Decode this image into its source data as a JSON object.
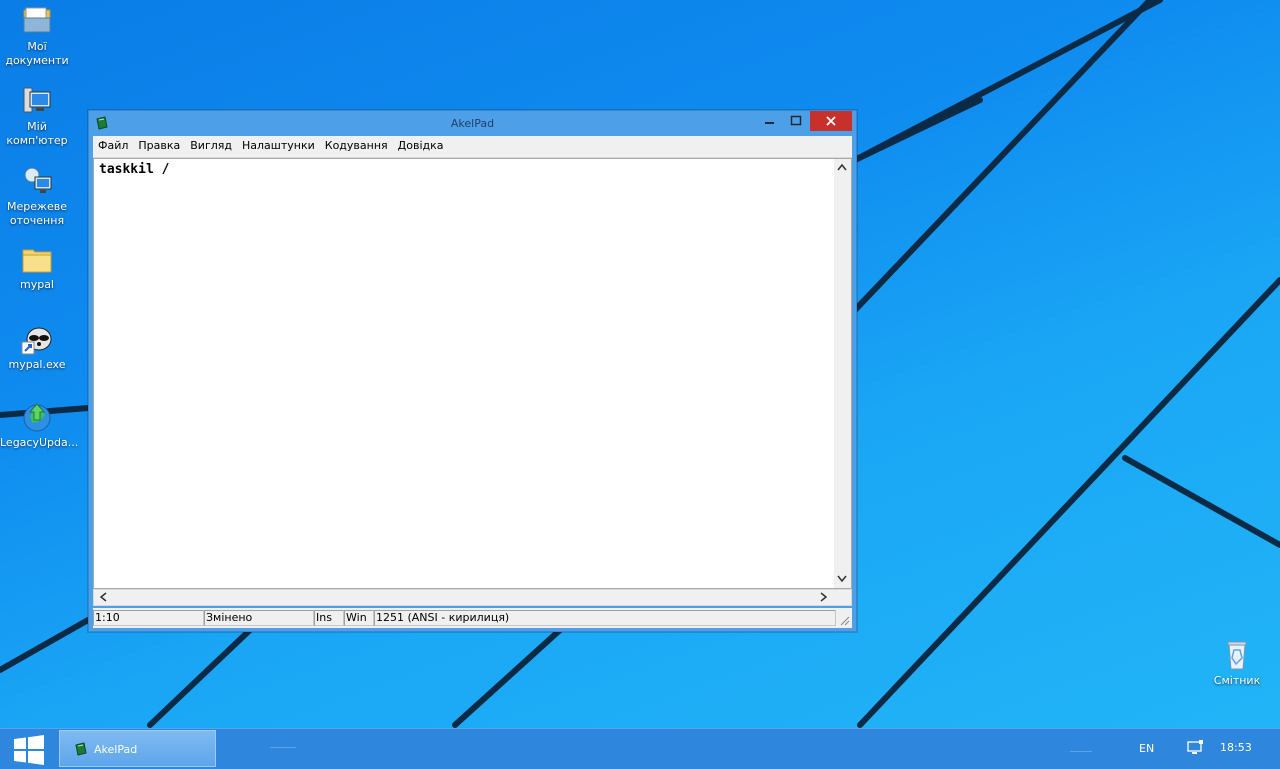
{
  "desktop": {
    "icons": [
      {
        "label_line1": "Мої",
        "label_line2": "документи",
        "icon": "documents-folder-icon"
      },
      {
        "label_line1": "Мій",
        "label_line2": "комп'ютер",
        "icon": "computer-icon"
      },
      {
        "label_line1": "Мережеве",
        "label_line2": "оточення",
        "icon": "network-icon"
      },
      {
        "label_line1": "mypal",
        "label_line2": "",
        "icon": "folder-icon"
      },
      {
        "label_line1": "mypal.exe",
        "label_line2": "",
        "icon": "mypal-raccoon-icon"
      },
      {
        "label_line1": "LegacyUpda...",
        "label_line2": "",
        "icon": "legacy-update-icon"
      }
    ],
    "recycle_bin": {
      "label": "Смітник",
      "icon": "recycle-bin-icon"
    }
  },
  "window": {
    "title": "AkelPad",
    "menu": [
      "Файл",
      "Правка",
      "Вигляд",
      "Налаштунки",
      "Кодування",
      "Довідка"
    ],
    "editor_text": "taskkil /",
    "status": {
      "position": "1:10",
      "modified": "Змінено",
      "insert_mode": "Ins",
      "newline": "Win",
      "codepage": "1251  (ANSI - кирилиця)"
    }
  },
  "taskbar": {
    "item_label": "AkelPad",
    "language": "EN",
    "clock": "18:53"
  },
  "colors": {
    "close_button": "#c7302b",
    "window_frame": "#4d9fe8",
    "taskbar": "#2f86dd"
  }
}
